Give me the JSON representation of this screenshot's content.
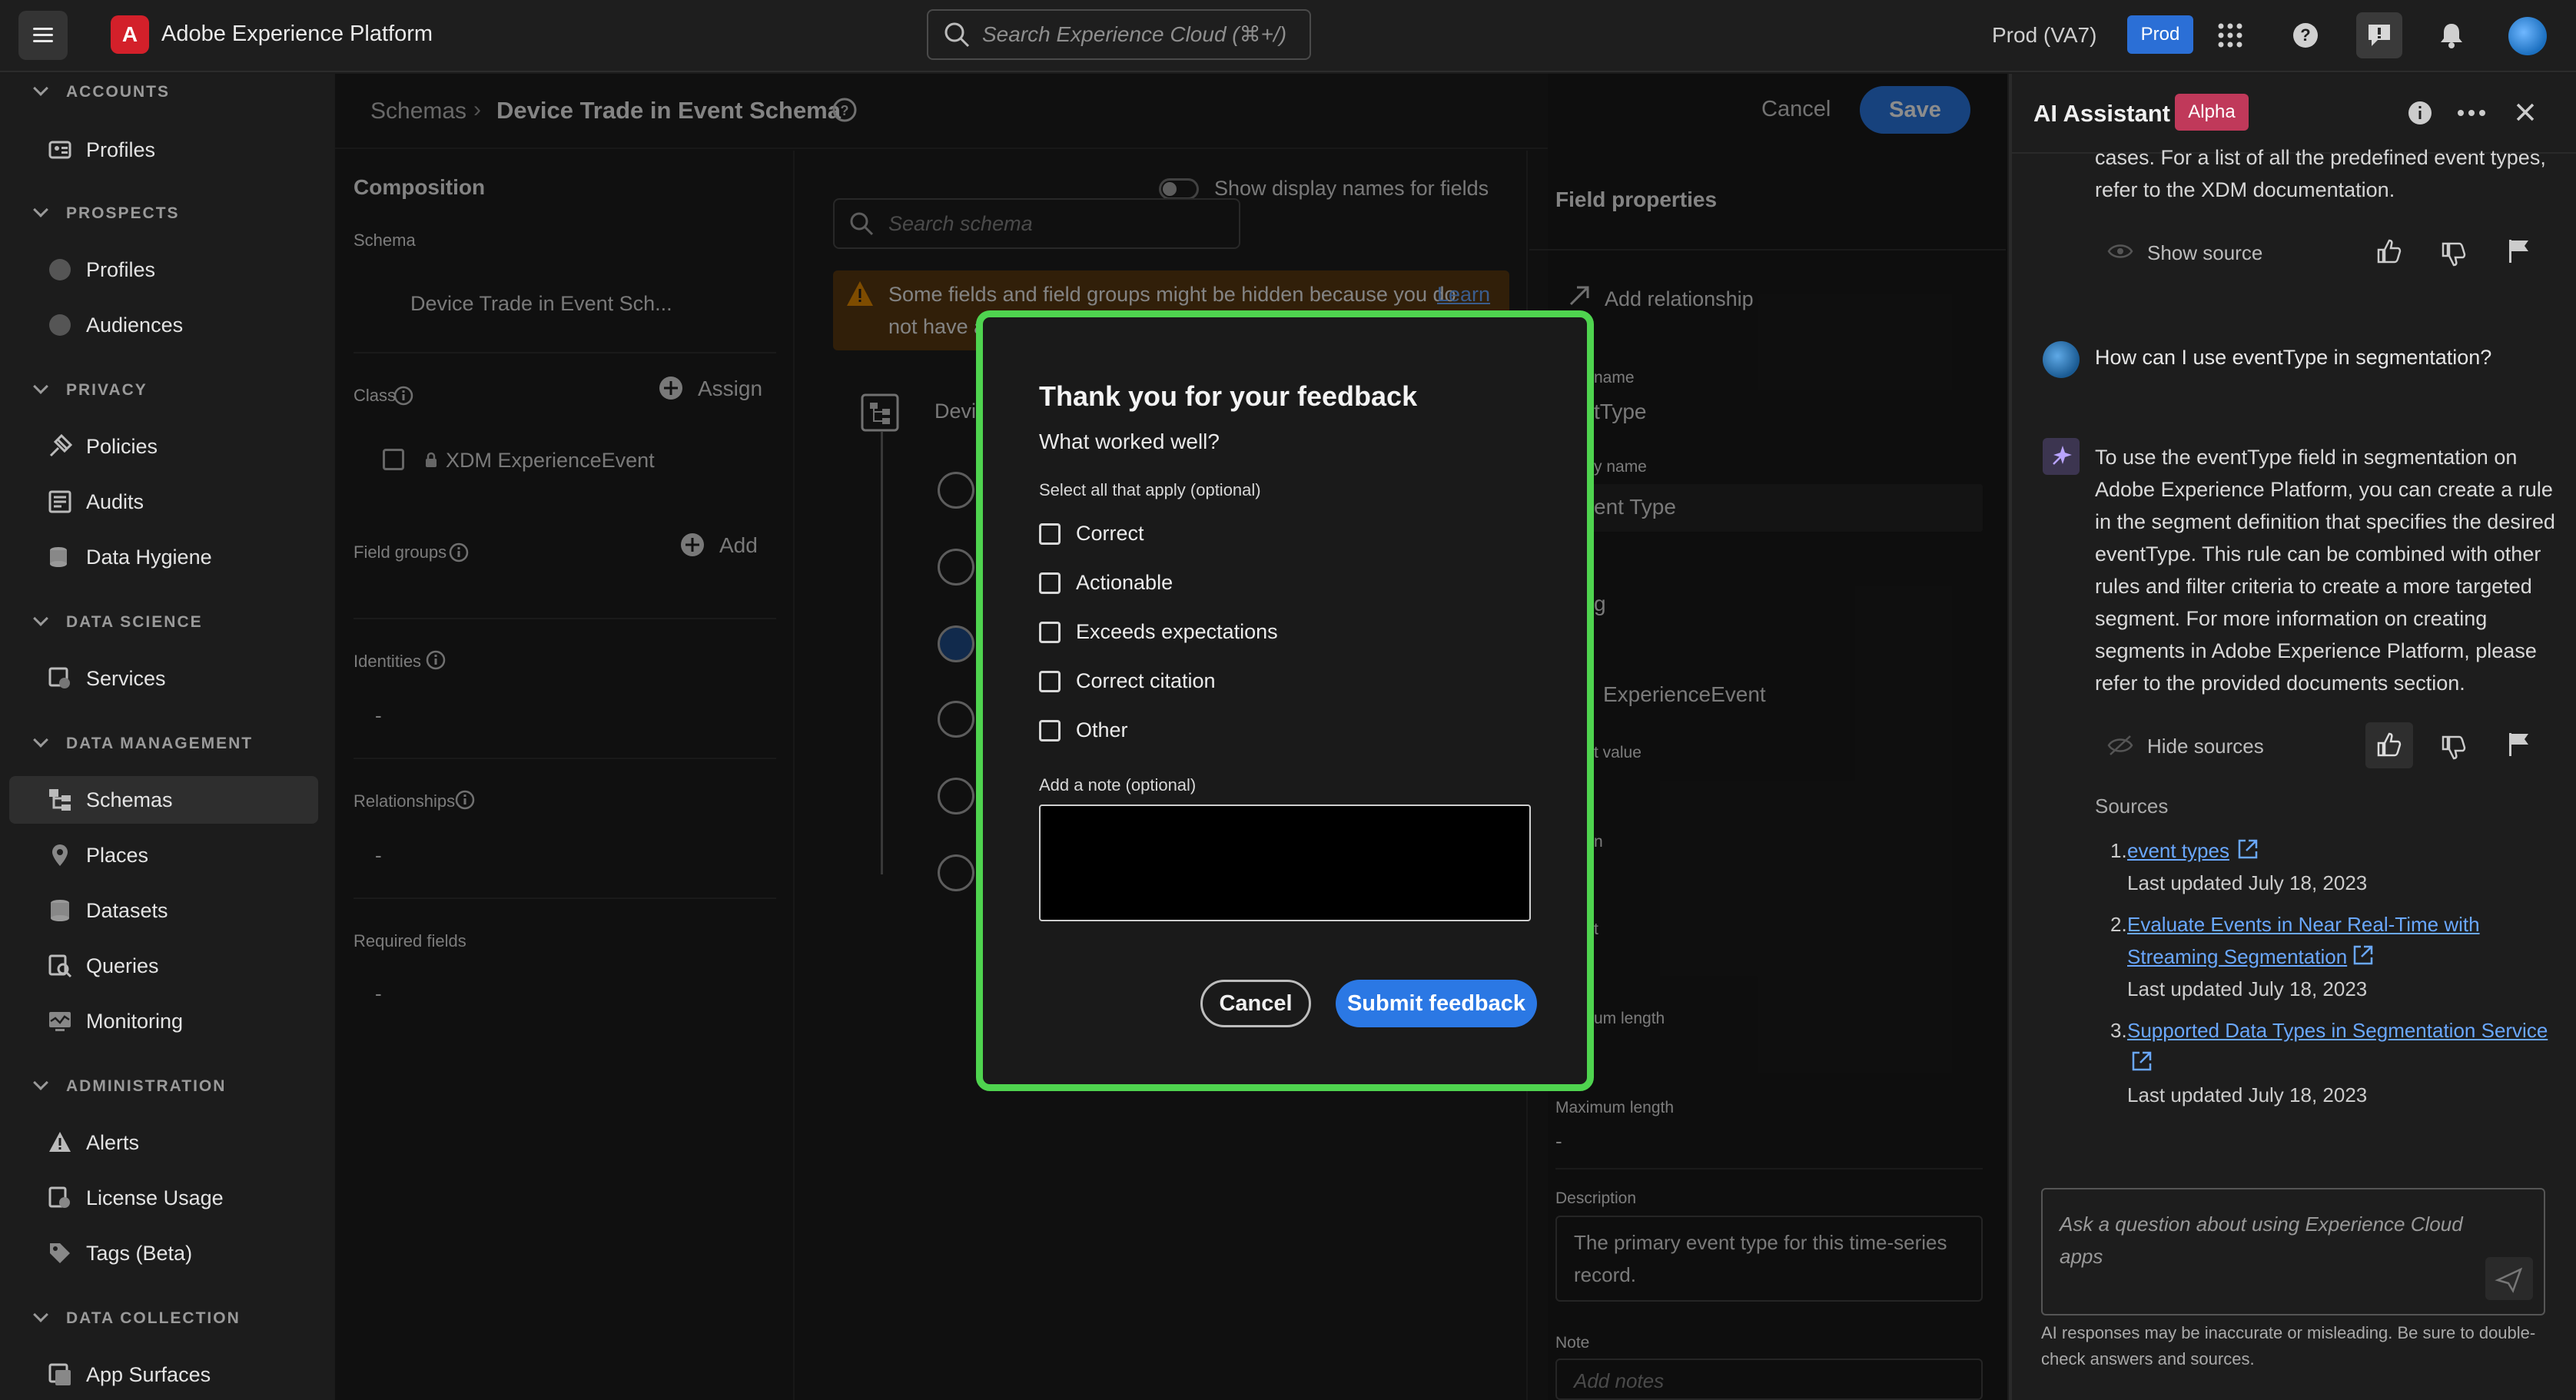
{
  "topbar": {
    "app_title": "Adobe Experience Platform",
    "search_placeholder": "Search Experience Cloud (⌘+/)",
    "environment": "Prod (VA7)",
    "env_badge": "Prod"
  },
  "leftnav": {
    "sections": [
      {
        "title": "ACCOUNTS",
        "items": [
          {
            "label": "Profiles",
            "icon": "profile-icon"
          }
        ]
      },
      {
        "title": "PROSPECTS",
        "items": [
          {
            "label": "Profiles",
            "icon": "circle-icon"
          },
          {
            "label": "Audiences",
            "icon": "circle-icon"
          }
        ]
      },
      {
        "title": "PRIVACY",
        "items": [
          {
            "label": "Policies",
            "icon": "policies-icon"
          },
          {
            "label": "Audits",
            "icon": "audits-icon"
          },
          {
            "label": "Data Hygiene",
            "icon": "data-hygiene-icon"
          }
        ]
      },
      {
        "title": "DATA SCIENCE",
        "items": [
          {
            "label": "Services",
            "icon": "services-icon"
          }
        ]
      },
      {
        "title": "DATA MANAGEMENT",
        "items": [
          {
            "label": "Schemas",
            "icon": "schemas-icon",
            "active": true
          },
          {
            "label": "Places",
            "icon": "places-icon"
          },
          {
            "label": "Datasets",
            "icon": "datasets-icon"
          },
          {
            "label": "Queries",
            "icon": "queries-icon"
          },
          {
            "label": "Monitoring",
            "icon": "monitoring-icon"
          }
        ]
      },
      {
        "title": "ADMINISTRATION",
        "items": [
          {
            "label": "Alerts",
            "icon": "alert-icon"
          },
          {
            "label": "License Usage",
            "icon": "license-icon"
          },
          {
            "label": "Tags (Beta)",
            "icon": "tag-icon"
          }
        ]
      },
      {
        "title": "DATA COLLECTION",
        "items": [
          {
            "label": "App Surfaces",
            "icon": "app-surfaces-icon"
          }
        ]
      }
    ]
  },
  "schema_header": {
    "breadcrumb_root": "Schemas",
    "title": "Device Trade in Event Schema",
    "cancel": "Cancel",
    "save": "Save"
  },
  "composition": {
    "title": "Composition",
    "schema_label": "Schema",
    "schema_value": "Device Trade in Event Sch...",
    "class_label": "Class",
    "assign": "Assign",
    "class_value": "XDM ExperienceEvent",
    "field_groups_label": "Field groups",
    "add": "Add",
    "identities_label": "Identities",
    "identities_value": "-",
    "relationships_label": "Relationships",
    "relationships_value": "-",
    "required_label": "Required fields",
    "required_value": "-"
  },
  "structure": {
    "toggle_label": "Show display names for fields",
    "search_placeholder": "Search schema",
    "warning_line1": "Some fields and field groups might be hidden because you do",
    "warning_link": "Learn",
    "warning_line2": "not have a",
    "root_node": "Devi"
  },
  "field_properties": {
    "title": "Field properties",
    "add_relationship": "Add relationship",
    "field_name_label": "name",
    "field_name_value": "tType",
    "display_name_label": "y name",
    "display_name_value": "ent Type",
    "type_partial": "g",
    "class_partial": "ExperienceEvent",
    "default_partial": "t value",
    "partial_n": "n",
    "partial_t": "t",
    "min_length_partial": "um length",
    "max_length_label": "Maximum length",
    "max_length_value": "-",
    "description_label": "Description",
    "description_value": "The primary event type for this time-series record.",
    "note_label": "Note",
    "note_placeholder": "Add notes"
  },
  "assistant": {
    "title": "AI Assistant",
    "badge": "Alpha",
    "prev_text_line1": "cases. For a list of all the predefined event types,",
    "prev_text_line2": "refer to the XDM documentation.",
    "show_source": "Show source",
    "user_question": "How can I use eventType in segmentation?",
    "answer": [
      "To use the eventType field in segmentation on",
      "Adobe Experience Platform, you can create a rule",
      "in the segment definition that specifies the desired",
      "eventType. This rule can be combined with other",
      "rules and filter criteria to create a more targeted",
      "segment. For more information on creating",
      "segments in Adobe Experience Platform, please",
      "refer to the provided documents section."
    ],
    "hide_sources": "Hide sources",
    "sources_label": "Sources",
    "sources": [
      {
        "num": "1.",
        "title_lines": [
          "event types"
        ],
        "updated": "Last updated July 18, 2023"
      },
      {
        "num": "2.",
        "title_lines": [
          "Evaluate Events in Near Real-Time with",
          "Streaming Segmentation"
        ],
        "updated": "Last updated July 18, 2023"
      },
      {
        "num": "3.",
        "title_lines": [
          "Supported Data Types in Segmentation Service"
        ],
        "updated": "Last updated July 18, 2023"
      }
    ],
    "input_placeholder_line1": "Ask a question about using Experience Cloud",
    "input_placeholder_line2": "apps",
    "disclaimer_line1": "AI responses may be inaccurate or misleading. Be sure to double-",
    "disclaimer_line2": "check answers and sources."
  },
  "modal": {
    "title": "Thank you for your feedback",
    "question": "What worked well?",
    "select_hint": "Select all that apply (optional)",
    "options": [
      "Correct",
      "Actionable",
      "Exceeds expectations",
      "Correct citation",
      "Other"
    ],
    "note_label": "Add a note (optional)",
    "note_value": "",
    "cancel": "Cancel",
    "submit": "Submit feedback",
    "highlight_color": "#4fd44f"
  },
  "colors": {
    "accent_blue": "#2b78e4",
    "adobe_red": "#d3202a",
    "alpha_badge": "#c0395a",
    "warning": "#e68a00"
  }
}
